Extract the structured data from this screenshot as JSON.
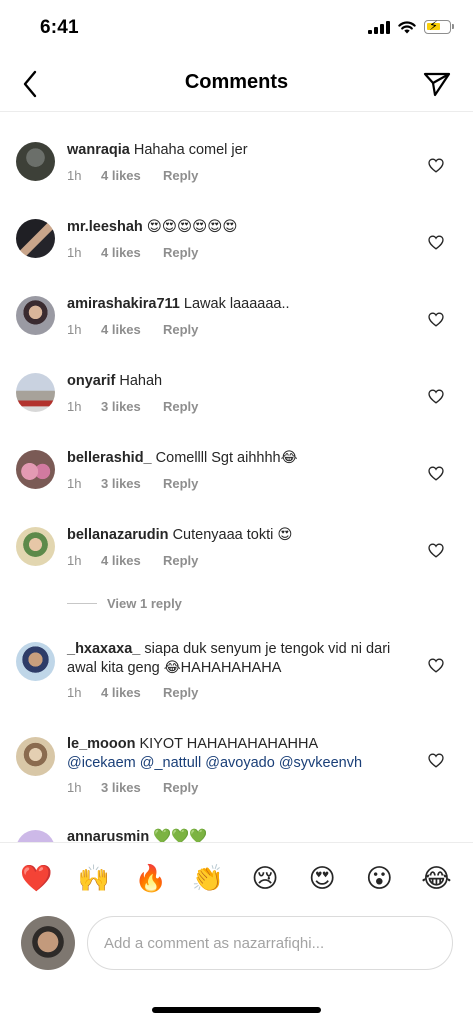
{
  "status_bar": {
    "time": "6:41"
  },
  "header": {
    "title": "Comments"
  },
  "comments": [
    {
      "username": "wanraqia",
      "text": "Hahaha comel jer",
      "time": "1h",
      "likes": "4 likes",
      "reply": "Reply"
    },
    {
      "username": "mr.leeshah",
      "text": "😍😍😍😍😍😍",
      "time": "1h",
      "likes": "4 likes",
      "reply": "Reply"
    },
    {
      "username": "amirashakira711",
      "text": "Lawak laaaaaa..",
      "time": "1h",
      "likes": "4 likes",
      "reply": "Reply"
    },
    {
      "username": "onyarif",
      "text": "Hahah",
      "time": "1h",
      "likes": "3 likes",
      "reply": "Reply"
    },
    {
      "username": "bellerashid_",
      "text": "Comellll Sgt aihhhh😂",
      "time": "1h",
      "likes": "3 likes",
      "reply": "Reply"
    },
    {
      "username": "bellanazarudin",
      "text": "Cutenyaaa tokti 😍",
      "time": "1h",
      "likes": "4 likes",
      "reply": "Reply"
    },
    {
      "username": "_hxaxaxa_",
      "text": "siapa duk senyum je tengok vid ni dari awal kita geng 😂HAHAHAHAHA",
      "time": "1h",
      "likes": "4 likes",
      "reply": "Reply"
    },
    {
      "username": "le_mooon",
      "text": "KIYOT HAHAHAHAHAHHA",
      "mentions": "@icekaem @_nattull @avoyado @syvkeenvh",
      "time": "1h",
      "likes": "3 likes",
      "reply": "Reply"
    },
    {
      "username": "annarusmin",
      "text": "💚💚💚"
    }
  ],
  "view_replies": "View 1 reply",
  "emoji_bar": [
    "❤️",
    "🙌",
    "🔥",
    "👏",
    "😢",
    "😍",
    "😮",
    "😂"
  ],
  "composer": {
    "placeholder": "Add a comment as nazarrafiqhi..."
  },
  "colors": {
    "text": "#262626",
    "secondary": "#8e8e8e",
    "mention": "#1a3f78",
    "battery": "#f9cf0a"
  }
}
